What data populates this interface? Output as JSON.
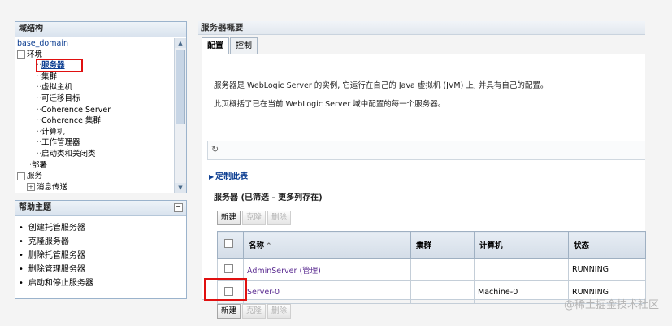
{
  "left": {
    "domain_panel_title": "域结构",
    "tree": [
      {
        "label": "base_domain",
        "indent": 0,
        "prefix": ""
      },
      {
        "label": "环境",
        "indent": 0,
        "prefix": "-"
      },
      {
        "label": "服务器",
        "indent": 2,
        "prefix": "",
        "selected": true
      },
      {
        "label": "集群",
        "indent": 2,
        "prefix": ""
      },
      {
        "label": "虚拟主机",
        "indent": 2,
        "prefix": ""
      },
      {
        "label": "可迁移目标",
        "indent": 2,
        "prefix": ""
      },
      {
        "label": "Coherence Server",
        "indent": 2,
        "prefix": ""
      },
      {
        "label": "Coherence 集群",
        "indent": 2,
        "prefix": ""
      },
      {
        "label": "计算机",
        "indent": 2,
        "prefix": ""
      },
      {
        "label": "工作管理器",
        "indent": 2,
        "prefix": ""
      },
      {
        "label": "启动类和关闭类",
        "indent": 2,
        "prefix": ""
      },
      {
        "label": "部署",
        "indent": 1,
        "prefix": ""
      },
      {
        "label": "服务",
        "indent": 0,
        "prefix": "-"
      },
      {
        "label": "消息传送",
        "indent": 1,
        "prefix": "+"
      }
    ],
    "help_panel_title": "帮助主题",
    "help_items": [
      "创建托管服务器",
      "克隆服务器",
      "删除托管服务器",
      "删除管理服务器",
      "启动和停止服务器"
    ]
  },
  "main": {
    "header": "服务器概要",
    "tabs": [
      "配置",
      "控制"
    ],
    "desc1": "服务器是 WebLogic Server 的实例, 它运行在自己的 Java 虚拟机 (JVM) 上, 并具有自己的配置。",
    "desc2": "此页概括了已在当前 WebLogic Server 域中配置的每一个服务器。",
    "customize": "定制此表",
    "table_title": "服务器 (已筛选 - 更多列存在)",
    "buttons": {
      "new": "新建",
      "clone": "克隆",
      "delete": "删除"
    },
    "columns": [
      "名称",
      "集群",
      "计算机",
      "状态"
    ],
    "rows": [
      {
        "name": "AdminServer (管理)",
        "cluster": "",
        "machine": "",
        "state": "RUNNING"
      },
      {
        "name": "Server-0",
        "cluster": "",
        "machine": "Machine-0",
        "state": "RUNNING"
      }
    ]
  },
  "watermark": "@稀土掘金技术社区"
}
